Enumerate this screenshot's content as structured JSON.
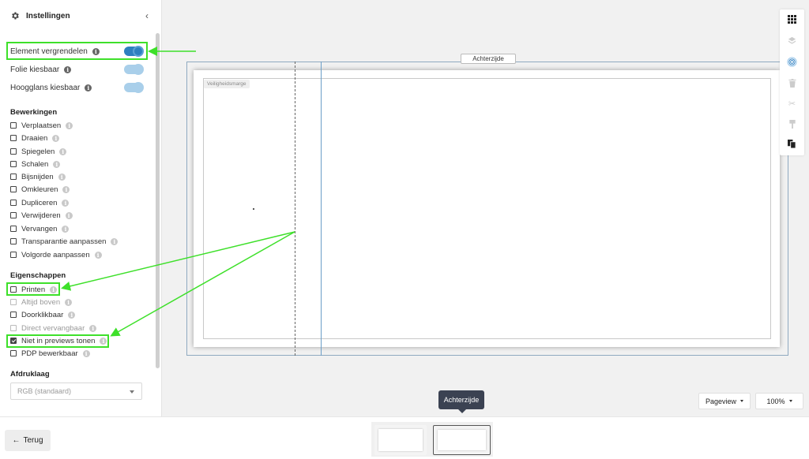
{
  "sidebar": {
    "title": "Instellingen",
    "header_icon": "gear-icon",
    "collapse_icon": "chevron-left-icon",
    "toggles": [
      {
        "label": "Element vergrendelen",
        "state": "on"
      },
      {
        "label": "Folie kiesbaar",
        "state": "on-disabled"
      },
      {
        "label": "Hoogglans kiesbaar",
        "state": "on-disabled"
      }
    ],
    "bewerkingen": {
      "title": "Bewerkingen",
      "items": [
        {
          "label": "Verplaatsen",
          "checked": false
        },
        {
          "label": "Draaien",
          "checked": false
        },
        {
          "label": "Spiegelen",
          "checked": false
        },
        {
          "label": "Schalen",
          "checked": false
        },
        {
          "label": "Bijsnijden",
          "checked": false
        },
        {
          "label": "Omkleuren",
          "checked": false
        },
        {
          "label": "Dupliceren",
          "checked": false
        },
        {
          "label": "Verwijderen",
          "checked": false
        },
        {
          "label": "Vervangen",
          "checked": false
        },
        {
          "label": "Transparantie aanpassen",
          "checked": false
        },
        {
          "label": "Volgorde aanpassen",
          "checked": false
        }
      ]
    },
    "eigenschappen": {
      "title": "Eigenschappen",
      "items": [
        {
          "label": "Printen",
          "checked": false,
          "disabled": false
        },
        {
          "label": "Altijd boven",
          "checked": false,
          "disabled": true
        },
        {
          "label": "Doorklikbaar",
          "checked": false,
          "disabled": false
        },
        {
          "label": "Direct vervangbaar",
          "checked": false,
          "disabled": true
        },
        {
          "label": "Niet in previews tonen",
          "checked": true,
          "disabled": false
        },
        {
          "label": "PDP bewerkbaar",
          "checked": false,
          "disabled": false
        }
      ]
    },
    "afdruklaag": {
      "title": "Afdruklaag",
      "selected": "RGB (standaard)"
    }
  },
  "canvas": {
    "page_tab": "Achterzijde",
    "safety_label": "Veiligheidsmarge"
  },
  "toolbar_icons": [
    "grid-icon",
    "layers-icon",
    "fingerprint-icon",
    "trash-icon",
    "cut-icon",
    "paint-icon",
    "copy-icon"
  ],
  "zoom": {
    "view_label": "Pageview",
    "zoom_label": "100%"
  },
  "tooltip": "Achterzijde",
  "bottom": {
    "back_label": "Terug"
  },
  "annotation_color": "#3ee02a",
  "accent_color": "#2e7fc0"
}
